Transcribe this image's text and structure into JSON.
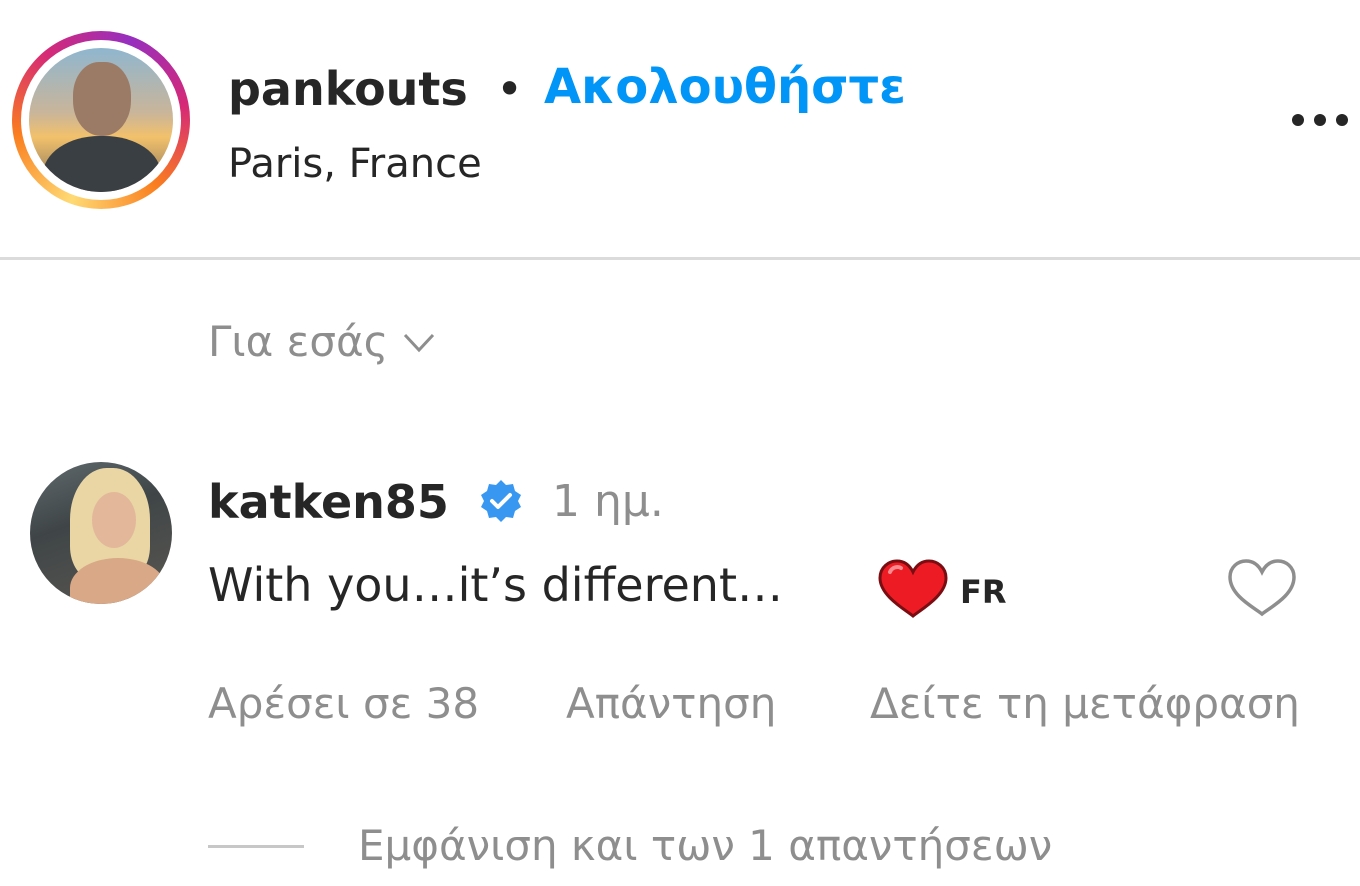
{
  "post": {
    "owner": {
      "username": "pankouts",
      "separator": "•",
      "follow_label": "Ακολουθήστε",
      "location": "Paris, France"
    },
    "more_icon": "more-options-icon"
  },
  "filter": {
    "label": "Για εσάς",
    "icon": "chevron-down-icon"
  },
  "comment": {
    "username": "katken85",
    "verified": true,
    "time": "1 ημ.",
    "text": "With you…it’s different…",
    "emoji": "red-heart",
    "language_tag": "FR",
    "likes_label": "Αρέσει σε 38",
    "reply_label": "Απάντηση",
    "translate_label": "Δείτε τη μετάφραση",
    "view_replies_label": "Εμφάνιση και των 1 απαντήσεων"
  },
  "colors": {
    "accent": "#0095f6",
    "text": "#262626",
    "secondary": "#8e8e8e",
    "divider": "#dbdbdb",
    "heart": "#ed1c24"
  }
}
